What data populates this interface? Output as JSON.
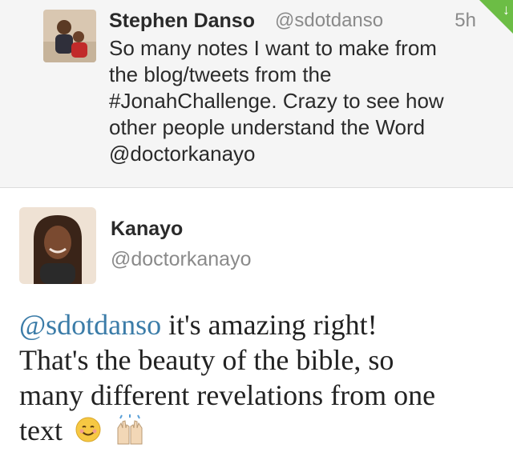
{
  "reply_tweet": {
    "name": "Stephen Danso",
    "handle": "@sdotdanso",
    "time": "5h",
    "text_lines": [
      "So many notes I want to make from",
      "the blog/tweets from the",
      "#JonahChallenge. Crazy to see how",
      "other people understand the Word",
      "@doctorkanayo"
    ],
    "avatar_icon": "user-photo-icon"
  },
  "main_tweet": {
    "name": "Kanayo",
    "handle": "@doctorkanayo",
    "mention": "@sdotdanso",
    "line1_rest": " it's amazing right!",
    "line2": "That's the beauty of the bible, so",
    "line3": "many different revelations from one",
    "line4": "text",
    "emojis": [
      "smiling-face-emoji",
      "raised-hands-emoji"
    ],
    "avatar_icon": "user-photo-icon"
  },
  "colors": {
    "mention": "#3b7ca8",
    "accent_corner": "#6cbd45",
    "name": "#2a2a2a",
    "muted": "#8a8a8a"
  }
}
